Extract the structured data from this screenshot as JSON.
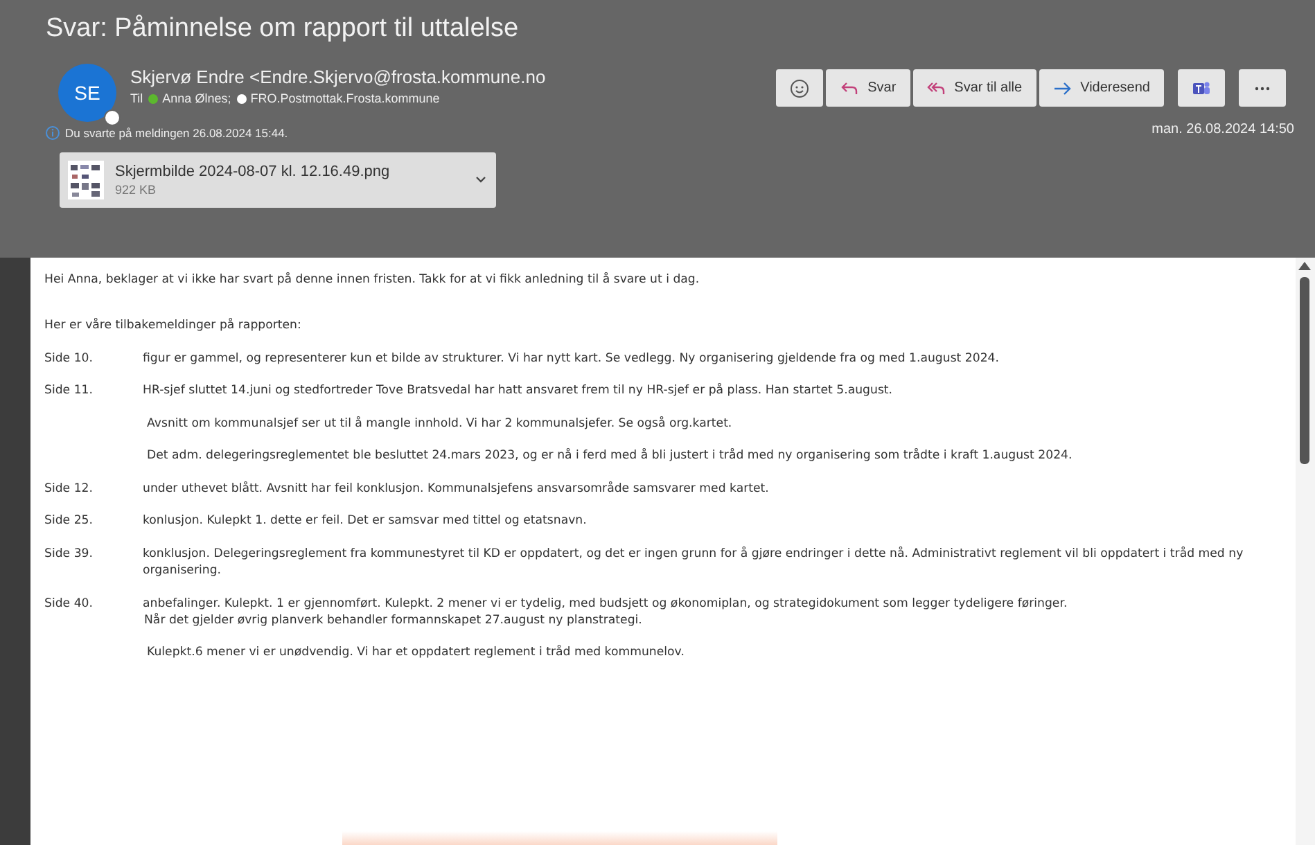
{
  "window": {
    "title": "Svar: Påminnelse om rapport til uttalelse"
  },
  "sender": {
    "initials": "SE",
    "name": "Skjervø Endre <Endre.Skjervo@frosta.kommune.no"
  },
  "recipients_label": "Til",
  "recipients": [
    {
      "name": "Anna Ølnes;",
      "color": "#5cb82e"
    },
    {
      "name": "FRO.Postmottak.Frosta.kommune",
      "color": "#ffffff"
    }
  ],
  "info": "Du svarte på meldingen 26.08.2024 15:44.",
  "attachment": {
    "name": "Skjermbilde 2024-08-07 kl. 12.16.49.png",
    "size": "922 KB"
  },
  "actions": [
    {
      "kind": "emoji"
    },
    {
      "kind": "reply",
      "label": "Svar"
    },
    {
      "kind": "reply-all",
      "label": "Svar til alle"
    },
    {
      "kind": "forward",
      "label": "Videresend"
    },
    {
      "kind": "teams"
    },
    {
      "kind": "more"
    }
  ],
  "date": "man. 26.08.2024 14:50",
  "body": [
    {
      "kind": "para",
      "text": "Hei Anna, beklager at vi ikke har svart på denne innen fristen. Takk for at vi fikk anledning til å svare ut i dag."
    },
    {
      "kind": "para",
      "text": "Her er våre tilbakemeldinger på rapporten:"
    },
    {
      "kind": "side",
      "label": "Side 10.",
      "text": "figur er gammel, og representerer kun et bilde av strukturer. Vi har nytt kart. Se vedlegg. Ny organisering gjeldende fra og med 1.august 2024."
    },
    {
      "kind": "side",
      "label": "Side 11.",
      "text": "HR-sjef sluttet 14.juni og stedfortreder Tove Bratsvedal har hatt ansvaret frem til ny HR-sjef er på plass. Han startet 5.august."
    },
    {
      "kind": "indent",
      "text": "Avsnitt om kommunalsjef ser ut til å mangle innhold. Vi har 2 kommunalsjefer. Se også org.kartet."
    },
    {
      "kind": "indent",
      "text": "Det adm. delegeringsreglementet ble besluttet 24.mars 2023, og er nå i ferd med å bli justert i tråd med ny organisering som trådte i kraft 1.august 2024."
    },
    {
      "kind": "side",
      "label": "Side 12.",
      "text": "under uthevet blått. Avsnitt har feil konklusjon. Kommunalsjefens ansvarsområde samsvarer med kartet."
    },
    {
      "kind": "side",
      "label": "Side 25.",
      "text": "konlusjon. Kulepkt 1. dette er feil. Det er samsvar med tittel og etatsnavn."
    },
    {
      "kind": "side",
      "label": "Side 39.",
      "text": "konklusjon. Delegeringsreglement fra kommunestyret til KD er oppdatert, og det er ingen grunn for å gjøre endringer i dette nå. Administrativt reglement vil bli oppdatert i tråd med ny organisering."
    },
    {
      "kind": "side",
      "label": "Side 40.",
      "text": "anbefalinger. Kulepkt. 1 er gjennomført. Kulepkt. 2 mener vi er tydelig, med budsjett og økonomiplan, og strategidokument som legger tydeligere føringer."
    },
    {
      "kind": "continuation",
      "text": "Når det gjelder øvrig planverk behandler formannskapet 27.august ny planstrategi."
    },
    {
      "kind": "indent",
      "text": "Kulepkt.6 mener vi er unødvendig. Vi har et oppdatert reglement i tråd med kommunelov."
    }
  ]
}
